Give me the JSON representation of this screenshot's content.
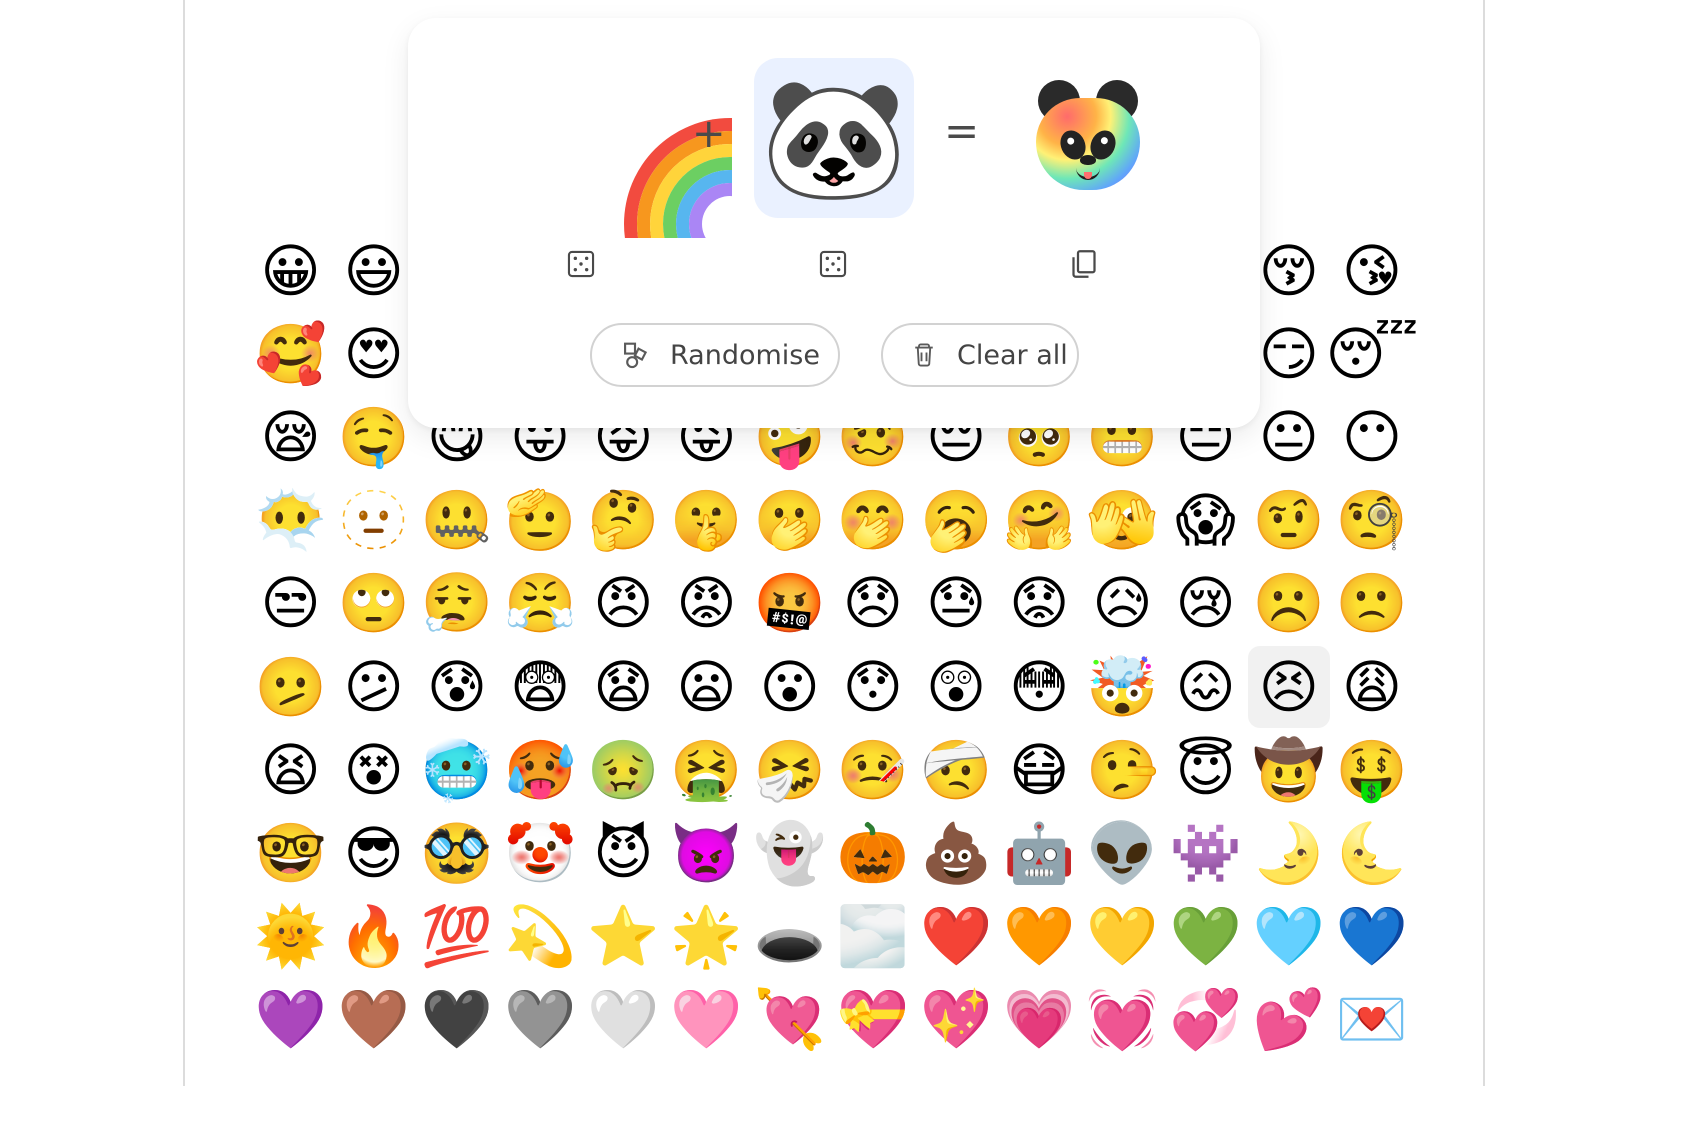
{
  "mixer": {
    "left_emoji_name": "rainbow",
    "right_emoji": "🐼",
    "result_name": "rainbow panda",
    "operators": {
      "plus": "+",
      "equals": "="
    },
    "actions": {
      "randomise": "Randomise",
      "clear_all": "Clear all"
    },
    "icons": {
      "left_dice": "dice-icon",
      "right_dice": "dice-icon",
      "copy": "copy-icon",
      "randomise": "shapes-icon",
      "clear_all": "trash-icon"
    }
  },
  "emoji_grid": {
    "items": [
      "😀",
      "😃",
      "😄",
      "😁",
      "😆",
      "😅",
      "🤣",
      "😂",
      "🙂",
      "🙃",
      "🫠",
      "😉",
      "😚",
      "😘",
      "🥰",
      "😍",
      "🤩",
      "😘",
      "😗",
      "☺️",
      "😚",
      "😙",
      "🥲",
      "😋",
      "😛",
      "😜",
      "😏",
      "😴",
      "😪",
      "🤤",
      "😋",
      "😛",
      "😝",
      "😜",
      "🤪",
      "🥴",
      "😔",
      "🥺",
      "😬",
      "😑",
      "😐",
      "😶",
      "😶‍🌫️",
      "🫥",
      "🤐",
      "🫡",
      "🤔",
      "🤫",
      "🫢",
      "🤭",
      "🥱",
      "🤗",
      "🫣",
      "😱",
      "🤨",
      "🧐",
      "😒",
      "🙄",
      "😮‍💨",
      "😤",
      "😠",
      "😡",
      "🤬",
      "😞",
      "😓",
      "😟",
      "😥",
      "😢",
      "☹️",
      "🙁",
      "🫤",
      "😕",
      "😰",
      "😨",
      "😧",
      "😦",
      "😮",
      "😯",
      "😲",
      "😳",
      "🤯",
      "😖",
      "😣",
      "😩",
      "😫",
      "😵",
      "🥶",
      "🥵",
      "🤢",
      "🤮",
      "🤧",
      "🤒",
      "🤕",
      "😷",
      "🤥",
      "😇",
      "🤠",
      "🤑",
      "🤓",
      "😎",
      "🥸",
      "🤡",
      "😈",
      "👿",
      "👻",
      "🎃",
      "💩",
      "🤖",
      "👽",
      "👾",
      "🌛",
      "🌜",
      "🌞",
      "🔥",
      "💯",
      "💫",
      "⭐",
      "🌟",
      "🕳️",
      "🌫️",
      "❤️",
      "🧡",
      "💛",
      "💚",
      "🩵",
      "💙",
      "💜",
      "🤎",
      "🖤",
      "🩶",
      "🤍",
      "🩷",
      "💘",
      "💝",
      "💖",
      "💗",
      "💓",
      "💞",
      "💕",
      "💌"
    ],
    "selected_index": 82
  }
}
